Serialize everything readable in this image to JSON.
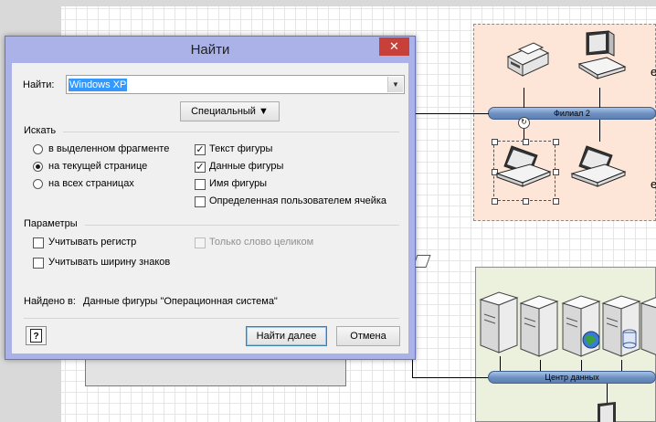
{
  "dialog": {
    "title": "Найти",
    "close_glyph": "✕",
    "find_label": "Найти:",
    "find_value": "Windows XP",
    "special_button": "Специальный",
    "search_section": {
      "title": "Искать",
      "scope_options": [
        {
          "label": "в выделенном фрагменте",
          "selected": false
        },
        {
          "label": "на текущей странице",
          "selected": true
        },
        {
          "label": "на всех страницах",
          "selected": false
        }
      ],
      "target_options": [
        {
          "label": "Текст фигуры",
          "checked": true
        },
        {
          "label": "Данные фигуры",
          "checked": true
        },
        {
          "label": "Имя фигуры",
          "checked": false
        },
        {
          "label": "Определенная пользователем ячейка",
          "checked": false
        }
      ]
    },
    "params_section": {
      "title": "Параметры",
      "options": [
        {
          "label": "Учитывать регистр",
          "checked": false,
          "enabled": true
        },
        {
          "label": "Учитывать ширину знаков",
          "checked": false,
          "enabled": true
        },
        {
          "label": "Только слово целиком",
          "checked": false,
          "enabled": false
        }
      ]
    },
    "found_label": "Найдено в:",
    "found_value": "Данные фигуры \"Операционная система\"",
    "find_next_button": "Найти далее",
    "cancel_button": "Отмена"
  },
  "diagram": {
    "branch_bus_label": "Филиал 2",
    "dc_bus_label": "Центр данных",
    "side_letters": [
      "е",
      "е"
    ]
  },
  "colors": {
    "dialog_frame": "#aab2e8",
    "close_button": "#c7413a",
    "branch_fill": "#fde6d7",
    "dc_fill": "#ebf1dd",
    "bus": "#6d8fc0",
    "selection_highlight": "#3399ff"
  }
}
